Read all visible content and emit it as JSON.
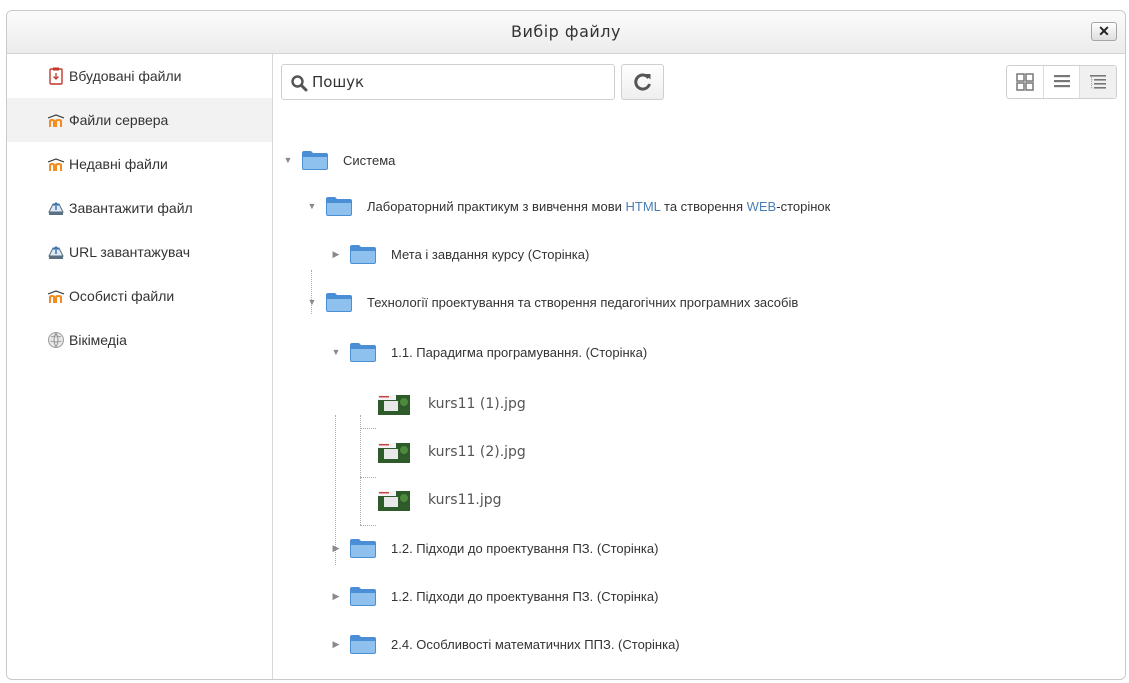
{
  "dialog": {
    "title": "Вибір файлу",
    "close_label": "✕"
  },
  "sidebar": {
    "items": [
      {
        "label": "Вбудовані файли",
        "icon": "embedded-files-icon"
      },
      {
        "label": "Файли сервера",
        "icon": "moodle-icon",
        "active": true
      },
      {
        "label": "Недавні файли",
        "icon": "moodle-icon"
      },
      {
        "label": "Завантажити файл",
        "icon": "upload-icon"
      },
      {
        "label": "URL завантажувач",
        "icon": "upload-icon"
      },
      {
        "label": "Особисті файли",
        "icon": "moodle-icon"
      },
      {
        "label": "Вікімедіа",
        "icon": "wikimedia-icon"
      }
    ]
  },
  "toolbar": {
    "search_placeholder": "Пошук",
    "refresh_icon": "refresh-icon",
    "views": [
      "icons-view-icon",
      "list-view-icon",
      "tree-view-icon"
    ],
    "active_view": "tree-view-icon"
  },
  "tree": {
    "root": "Система",
    "course1": "Лабораторний практикум з вивчення мови HTML та створення WEB-сторінок",
    "course1_pre": "Лабораторний практикум з вивчення мови ",
    "course1_hl1": "HTML",
    "course1_mid": " та створення ",
    "course1_hl2": "WEB",
    "course1_post": "-сторінок",
    "course1_page": "Мета і завдання курсу (Сторінка)",
    "course2": "Технології проектування та створення педагогічних програмних засобів",
    "page1": "1.1. Парадигма програмування. (Сторінка)",
    "files": [
      "kurs11 (1).jpg",
      "kurs11 (2).jpg",
      "kurs11.jpg"
    ],
    "page2": "1.2. Підходи до проектування ПЗ. (Сторінка)",
    "page3": "1.2. Підходи до проектування ПЗ. (Сторінка)",
    "page4": "2.4. Особливості математичних ППЗ. (Сторінка)"
  },
  "colors": {
    "folder": "#4a8fd6",
    "moodle_orange": "#f48c1e",
    "highlight": "#4a7fb3"
  }
}
